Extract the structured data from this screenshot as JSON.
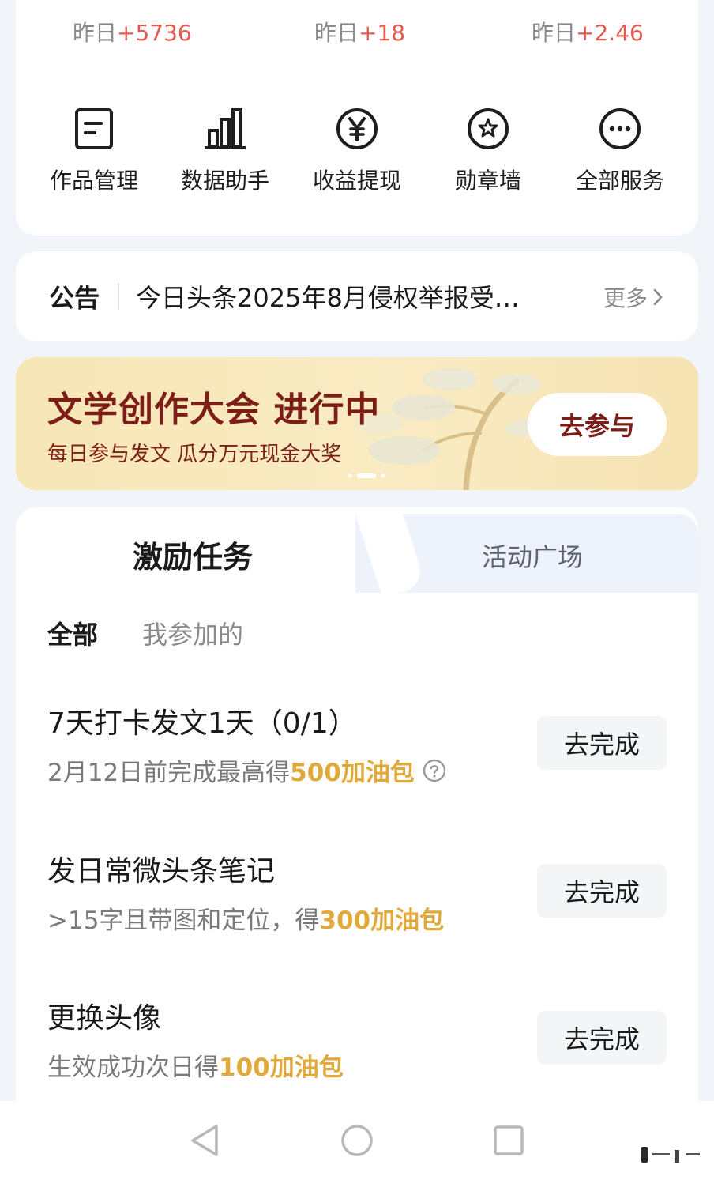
{
  "stats": [
    {
      "label": "昨日",
      "delta": "+5736"
    },
    {
      "label": "昨日",
      "delta": "+18"
    },
    {
      "label": "昨日",
      "delta": "+2.46"
    }
  ],
  "services": [
    {
      "label": "作品管理",
      "icon": "document-icon"
    },
    {
      "label": "数据助手",
      "icon": "bar-chart-icon"
    },
    {
      "label": "收益提现",
      "icon": "yuan-coin-icon"
    },
    {
      "label": "勋章墙",
      "icon": "medal-star-icon"
    },
    {
      "label": "全部服务",
      "icon": "more-dots-icon"
    }
  ],
  "notice": {
    "tag": "公告",
    "text": "今日头条2025年8月侵权举报受…",
    "more": "更多"
  },
  "banner": {
    "title": "文学创作大会 进行中",
    "subtitle": "每日参与发文 瓜分万元现金大奖",
    "button": "去参与"
  },
  "tabs": {
    "active": "激励任务",
    "inactive": "活动广场"
  },
  "filters": {
    "all": "全部",
    "joined": "我参加的"
  },
  "tasks": [
    {
      "title": "7天打卡发文1天（0/1）",
      "desc": "2月12日前完成最高得",
      "reward": "500加油包",
      "button": "去完成"
    },
    {
      "title": "发日常微头条笔记",
      "desc": ">15字且带图和定位，得",
      "reward": "300加油包",
      "button": "去完成"
    },
    {
      "title": "更换头像",
      "desc": "生效成功次日得",
      "reward": "100加油包",
      "button": "去完成"
    }
  ],
  "colors": {
    "accent_red": "#e25b4f",
    "reward_gold": "#e0a93a",
    "banner_text": "#7c1d17",
    "page_bg": "#f1f4f9"
  }
}
